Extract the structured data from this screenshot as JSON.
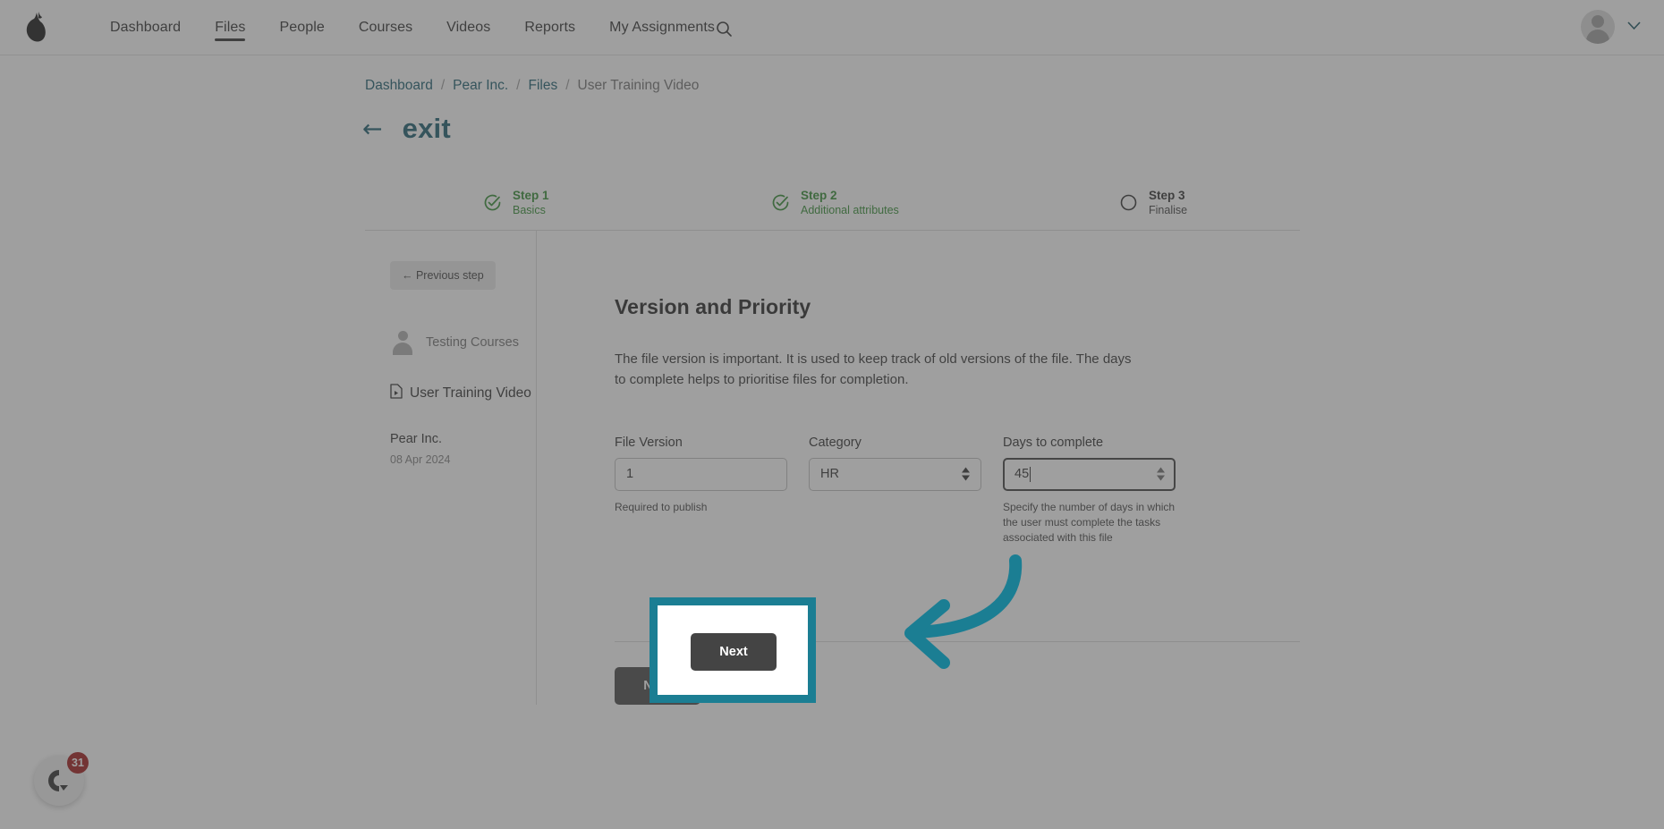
{
  "nav": {
    "logo_icon": "pear-logo-icon",
    "items": [
      {
        "label": "Dashboard",
        "active": false
      },
      {
        "label": "Files",
        "active": true
      },
      {
        "label": "People",
        "active": false
      },
      {
        "label": "Courses",
        "active": false
      },
      {
        "label": "Videos",
        "active": false
      },
      {
        "label": "Reports",
        "active": false
      },
      {
        "label": "My Assignments",
        "active": false
      }
    ],
    "search_icon": "search-icon",
    "account_chevron_icon": "chevron-down-icon"
  },
  "breadcrumb": {
    "items": [
      "Dashboard",
      "Pear Inc.",
      "Files",
      "User Training Video"
    ],
    "separator": "/"
  },
  "exit": {
    "arrow": "←",
    "label": "exit"
  },
  "stepper": {
    "steps": [
      {
        "title": "Step 1",
        "subtitle": "Basics",
        "state": "done"
      },
      {
        "title": "Step 2",
        "subtitle": "Additional attributes",
        "state": "done"
      },
      {
        "title": "Step 3",
        "subtitle": "Finalise",
        "state": "todo"
      }
    ]
  },
  "sidebar": {
    "previous_step_label": "← Previous step",
    "user_name": "Testing Courses",
    "file_name": "User Training Video",
    "organisation": "Pear Inc.",
    "date": "08 Apr 2024"
  },
  "main": {
    "heading": "Version and Priority",
    "description": "The file version is important. It is used to keep track of old versions of the file. The days to complete helps to prioritise files for completion.",
    "fields": {
      "file_version": {
        "label": "File Version",
        "value": "1",
        "help": "Required to publish"
      },
      "category": {
        "label": "Category",
        "value": "HR",
        "options": [
          "HR"
        ]
      },
      "days_to_complete": {
        "label": "Days to complete",
        "value": "45",
        "help": "Specify the number of days in which the user must complete the tasks associated with this file",
        "focused": true
      }
    },
    "next_label": "Next"
  },
  "chat_widget": {
    "icon": "chat-widget-icon",
    "badge_count": "31"
  },
  "colors": {
    "brand_teal": "#14596b",
    "highlight_teal": "#1b7e93",
    "step_done_green": "#2e8b2e",
    "button_dark": "#444444",
    "badge_red": "#9e1212"
  }
}
